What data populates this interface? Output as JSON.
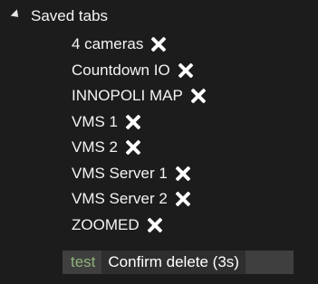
{
  "saved_tabs": {
    "header_label": "Saved tabs",
    "items": [
      {
        "label": "4 cameras"
      },
      {
        "label": "Countdown IO"
      },
      {
        "label": "INNOPOLI MAP"
      },
      {
        "label": "VMS 1"
      },
      {
        "label": "VMS 2"
      },
      {
        "label": "VMS Server 1"
      },
      {
        "label": "VMS Server 2"
      },
      {
        "label": "ZOOMED"
      }
    ],
    "pending_delete": {
      "name": "test",
      "confirm_label": "Confirm delete (3s)"
    }
  },
  "colors": {
    "background": "#1c1c1c",
    "text": "#f4f4f4",
    "pending_name": "#8fb27a",
    "confirm_row": "#3f3f3f",
    "confirm_button": "#2e2e2e"
  }
}
